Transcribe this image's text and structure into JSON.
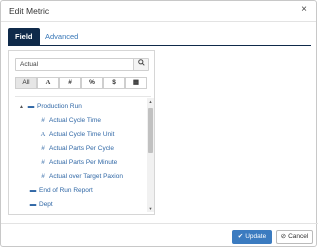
{
  "dialog": {
    "title": "Edit Metric",
    "close_icon": "×"
  },
  "tabs": [
    {
      "label": "Field",
      "active": true
    },
    {
      "label": "Advanced",
      "active": false
    }
  ],
  "search": {
    "value": "Actual",
    "icon": "⌕"
  },
  "filters": [
    {
      "label": "All",
      "icon": "all",
      "active": true
    },
    {
      "label": "A",
      "icon": "text-icon"
    },
    {
      "label": "#",
      "icon": "number-icon"
    },
    {
      "label": "%",
      "icon": "percent-icon"
    },
    {
      "label": "$",
      "icon": "currency-icon"
    },
    {
      "label": "▦",
      "icon": "calendar-icon"
    }
  ],
  "tree": {
    "caret": "▲",
    "folder_icon": "▬",
    "nodes": [
      {
        "label": "Production Run",
        "type": "folder",
        "expanded": true
      },
      {
        "label": "Actual Cycle Time",
        "type": "number",
        "icon_glyph": "#"
      },
      {
        "label": "Actual Cycle Time Unit",
        "type": "text",
        "icon_glyph": "A"
      },
      {
        "label": "Actual Parts Per Cycle",
        "type": "number",
        "icon_glyph": "#"
      },
      {
        "label": "Actual Parts Per Minute",
        "type": "number",
        "icon_glyph": "#"
      },
      {
        "label": "Actual over Target Paxion",
        "type": "number",
        "icon_glyph": "#"
      },
      {
        "label": "End of Run Report",
        "type": "folder"
      },
      {
        "label": "Dept",
        "type": "folder"
      }
    ]
  },
  "buttons": {
    "update_label": "Update",
    "update_icon": "✔",
    "cancel_label": "Cancel",
    "cancel_icon": "⊘"
  },
  "colors": {
    "accent": "#3b7bc0",
    "tab_active": "#0f2a4a",
    "link": "#3168a6"
  }
}
